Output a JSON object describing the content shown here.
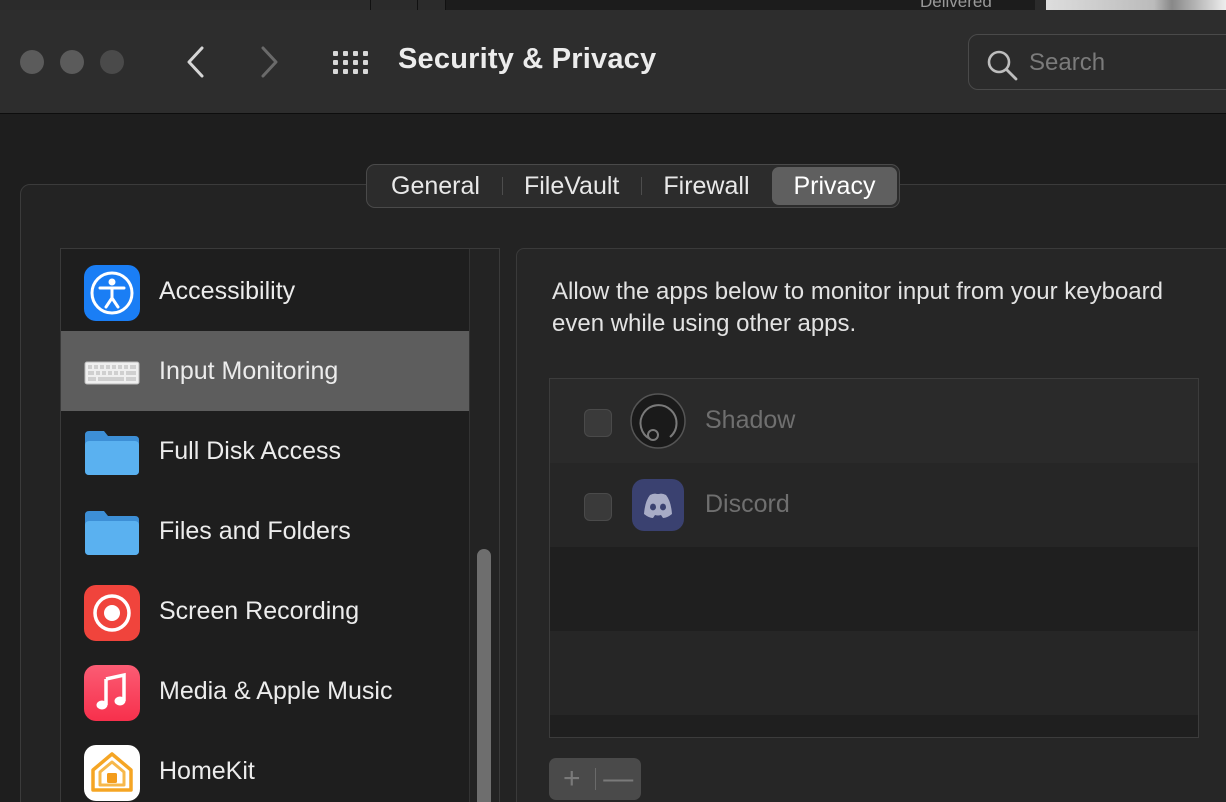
{
  "background_window": {
    "delivered_text": "Delivered"
  },
  "toolbar": {
    "title": "Security & Privacy",
    "search_placeholder": "Search"
  },
  "tabs": [
    {
      "label": "General",
      "selected": false
    },
    {
      "label": "FileVault",
      "selected": false
    },
    {
      "label": "Firewall",
      "selected": false
    },
    {
      "label": "Privacy",
      "selected": true
    }
  ],
  "sidebar": {
    "items": [
      {
        "label": "Accessibility",
        "icon": "accessibility-icon",
        "selected": false
      },
      {
        "label": "Input Monitoring",
        "icon": "keyboard-icon",
        "selected": true
      },
      {
        "label": "Full Disk Access",
        "icon": "folder-icon",
        "selected": false
      },
      {
        "label": "Files and Folders",
        "icon": "folder-icon",
        "selected": false
      },
      {
        "label": "Screen Recording",
        "icon": "screen-recording-icon",
        "selected": false
      },
      {
        "label": "Media & Apple Music",
        "icon": "music-icon",
        "selected": false
      },
      {
        "label": "HomeKit",
        "icon": "homekit-icon",
        "selected": false
      }
    ]
  },
  "detail": {
    "description": "Allow the apps below to monitor input from your keyboard even while using other apps.",
    "apps": [
      {
        "name": "Shadow",
        "icon": "shadow-app-icon",
        "checked": false
      },
      {
        "name": "Discord",
        "icon": "discord-icon",
        "checked": false
      }
    ],
    "add_label": "+",
    "remove_label": "—"
  },
  "colors": {
    "window_bg": "#1e1e1e",
    "toolbar_bg": "#2d2d2d",
    "selected_row": "#5d5d5d",
    "accessibility_blue": "#1a7ef5",
    "folder_blue": "#5ab1f0",
    "recording_red": "#f0443c",
    "music_pink": "#f8435f",
    "discord_blurple": "#5865f2"
  }
}
